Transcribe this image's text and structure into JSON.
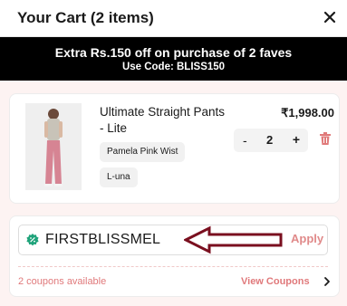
{
  "header": {
    "title": "Your Cart (2 items)",
    "close_icon": "close-icon"
  },
  "promo": {
    "line1": "Extra Rs.150 off on purchase of 2 faves",
    "line2": "Use Code: BLISS150"
  },
  "cart_item": {
    "name": "Ultimate Straight Pants - Lite",
    "price": "₹1,998.00",
    "color_label": "Pamela Pink Wist",
    "size_label": "L-una",
    "quantity": "2",
    "minus_label": "-",
    "plus_label": "+",
    "delete_icon": "trash-icon",
    "image_icon": "product-image"
  },
  "coupon": {
    "code": "FIRSTBLISSMEL",
    "apply_label": "Apply",
    "available_text": "2 coupons available",
    "view_label": "View Coupons",
    "coupon_icon": "coupon-badge-icon",
    "chevron_icon": "chevron-right-icon"
  },
  "colors": {
    "accent": "#e0797b",
    "apply": "#e08a8a",
    "area_bg": "#fdf3f2",
    "promo_bg": "#000000",
    "arrow": "#7a0f1f",
    "trash": "#e07a7a",
    "coupon_icon": "#1fa37a"
  }
}
